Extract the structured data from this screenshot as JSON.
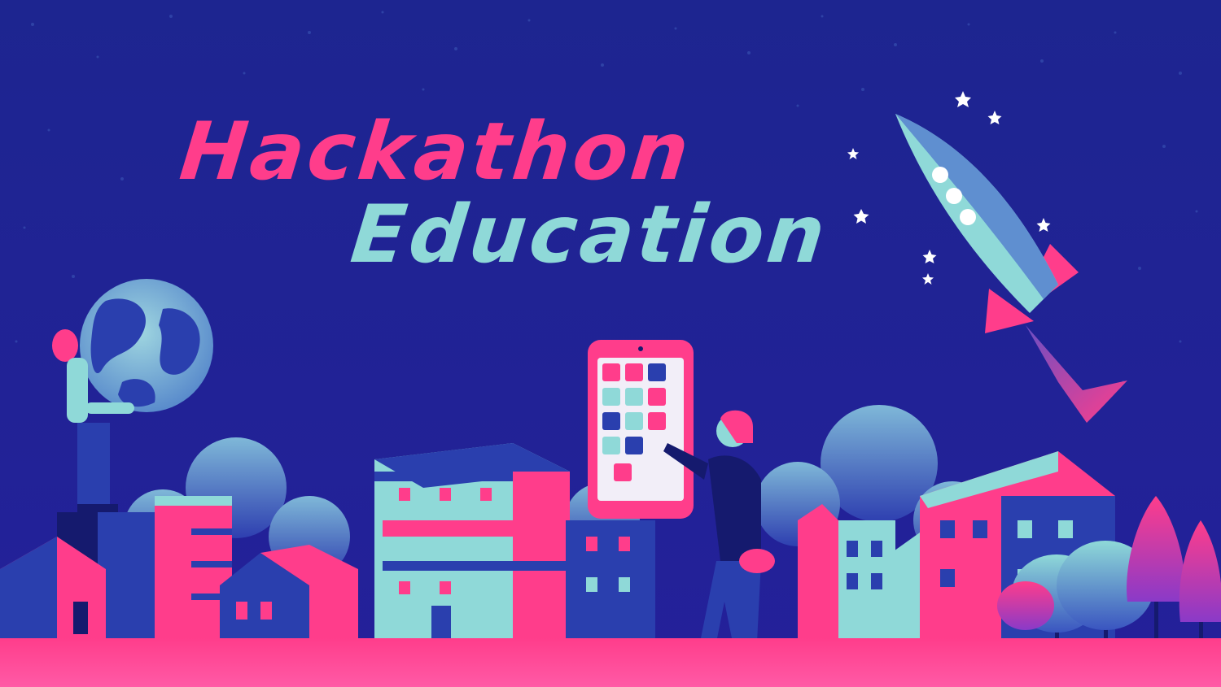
{
  "title": {
    "line1": "Hackathon",
    "line2": "Education"
  },
  "colors": {
    "sky_top": "#1d2590",
    "sky_bottom": "#24209a",
    "pink": "#ff3d8b",
    "teal": "#8fd9d8",
    "navy": "#1c2a9e",
    "dark": "#151a6e",
    "cloud": "#4d78c8"
  },
  "illustration": {
    "icons": [
      "globe-icon",
      "rocket-icon",
      "smartphone-icon",
      "star-icon",
      "building-icon",
      "tree-icon",
      "cloud-icon",
      "person-icon"
    ]
  }
}
